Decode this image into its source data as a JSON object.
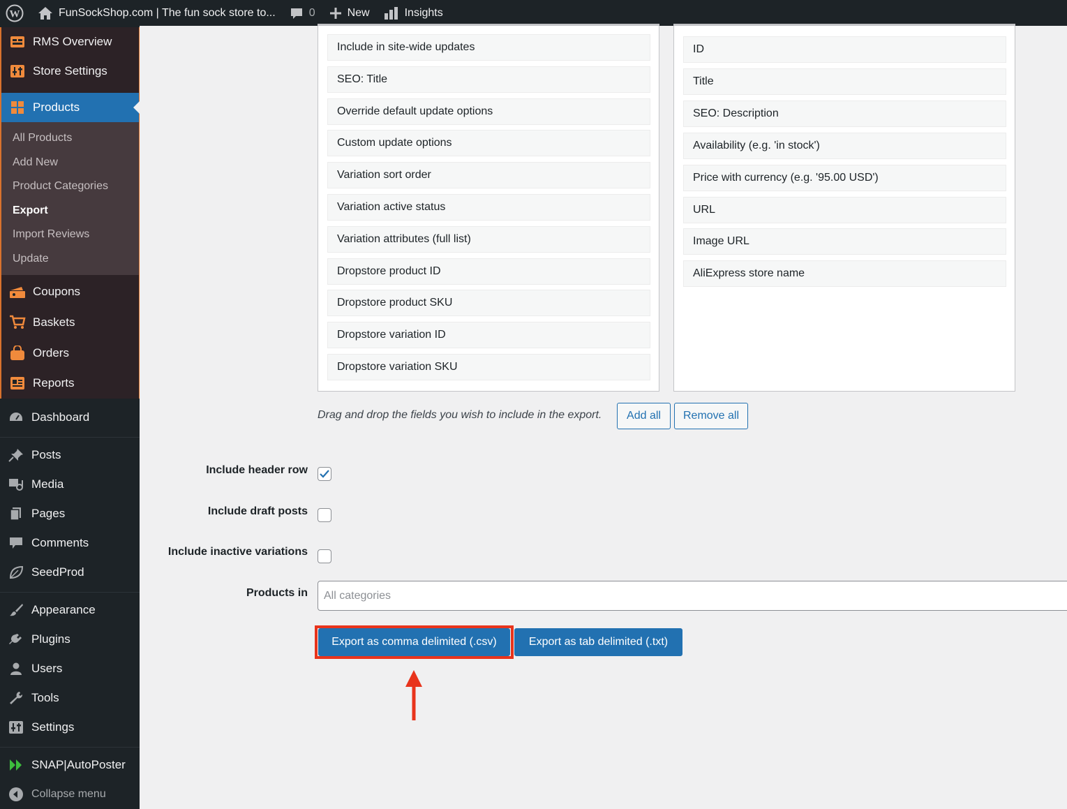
{
  "adminbar": {
    "site_title": "FunSockShop.com | The fun sock store to...",
    "comments_count": "0",
    "new_label": "New",
    "insights_label": "Insights"
  },
  "sidebar": {
    "rms_items": [
      {
        "label": "RMS Overview",
        "icon": "rms-overview-icon"
      },
      {
        "label": "Store Settings",
        "icon": "store-settings-icon"
      }
    ],
    "products_label": "Products",
    "products_submenu": [
      "All Products",
      "Add New",
      "Product Categories",
      "Export",
      "Import Reviews",
      "Update"
    ],
    "rms_items_after": [
      {
        "label": "Coupons",
        "icon": "coupons-icon"
      },
      {
        "label": "Baskets",
        "icon": "basket-icon"
      },
      {
        "label": "Orders",
        "icon": "orders-icon"
      },
      {
        "label": "Reports",
        "icon": "reports-icon"
      }
    ],
    "dashboard": "Dashboard",
    "group1": [
      "Posts",
      "Media",
      "Pages",
      "Comments",
      "SeedProd"
    ],
    "group2": [
      "Appearance",
      "Plugins",
      "Users",
      "Tools",
      "Settings"
    ],
    "snap": "SNAP|AutoPoster",
    "collapse": "Collapse menu"
  },
  "available_fields": [
    "Include in site-wide updates",
    "SEO: Title",
    "Override default update options",
    "Custom update options",
    "Variation sort order",
    "Variation active status",
    "Variation attributes (full list)",
    "Dropstore product ID",
    "Dropstore product SKU",
    "Dropstore variation ID",
    "Dropstore variation SKU"
  ],
  "selected_fields": [
    "ID",
    "Title",
    "SEO: Description",
    "Availability (e.g. 'in stock')",
    "Price with currency (e.g. '95.00 USD')",
    "URL",
    "Image URL",
    "AliExpress store name"
  ],
  "help_text": "Drag and drop the fields you wish to include in the export.",
  "add_all_label": "Add all",
  "remove_all_label": "Remove all",
  "options": {
    "header_row_label": "Include header row",
    "header_row_checked": true,
    "draft_posts_label": "Include draft posts",
    "draft_posts_checked": false,
    "inactive_variations_label": "Include inactive variations",
    "inactive_variations_checked": false,
    "products_in_label": "Products in",
    "products_in_placeholder": "All categories"
  },
  "export_csv_label": "Export as comma delimited (.csv)",
  "export_txt_label": "Export as tab delimited (.txt)",
  "colors": {
    "accent": "#2271b1",
    "highlight": "#e8341c",
    "rms_orange": "#d9722d"
  }
}
